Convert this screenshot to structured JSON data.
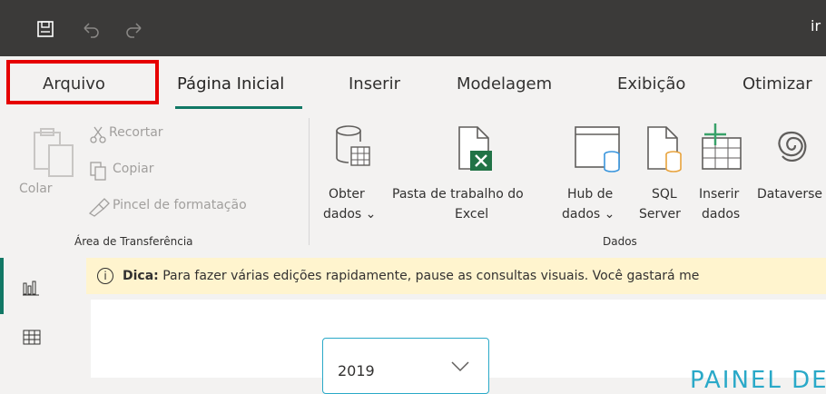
{
  "title_bar": {
    "title": "ir"
  },
  "tabs": [
    {
      "label": "Arquivo"
    },
    {
      "label": "Página Inicial"
    },
    {
      "label": "Inserir"
    },
    {
      "label": "Modelagem"
    },
    {
      "label": "Exibição"
    },
    {
      "label": "Otimizar"
    }
  ],
  "ribbon": {
    "clipboard": {
      "paste": "Colar",
      "cut": "Recortar",
      "copy": "Copiar",
      "format_painter": "Pincel de formatação",
      "group_label": "Área de Transferência"
    },
    "data": {
      "get_data_line1": "Obter",
      "get_data_line2": "dados",
      "excel_line1": "Pasta de trabalho do",
      "excel_line2": "Excel",
      "hub_line1": "Hub de",
      "hub_line2": "dados",
      "sql_line1": "SQL",
      "sql_line2": "Server",
      "insert_line1": "Inserir",
      "insert_line2": "dados",
      "dataverse": "Dataverse",
      "group_label": "Dados"
    }
  },
  "tip": {
    "prefix": "Dica:",
    "text": "Para fazer várias edições rapidamente, pause as consultas visuais. Você gastará me"
  },
  "canvas": {
    "slicer_value": "2019",
    "panel_title": "PAINEL DE"
  },
  "colors": {
    "title_bar": "#3b3a39",
    "accent_underline": "#117865",
    "highlight_box": "#e60000",
    "tip_bg": "#fff4ce",
    "excel_green": "#217346",
    "db_orange": "#e8a33d",
    "db_blue": "#3a96dd",
    "canvas_title": "#2aa9c8"
  }
}
